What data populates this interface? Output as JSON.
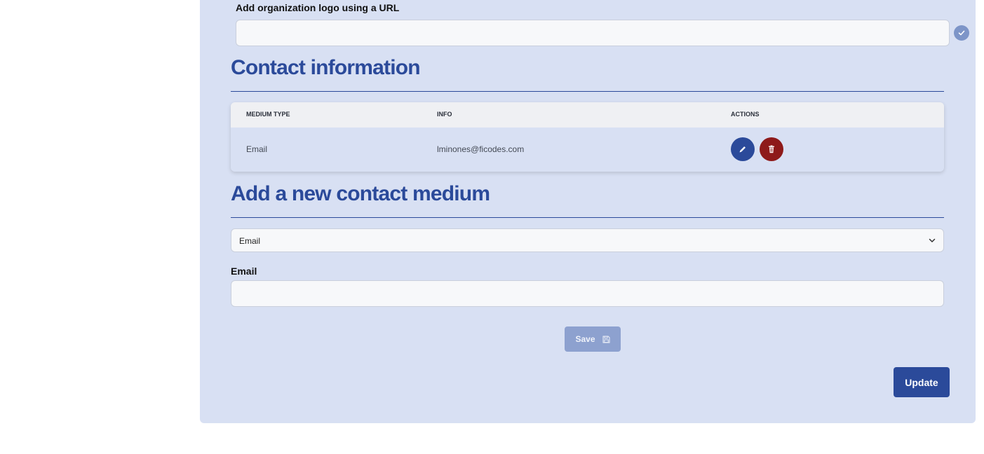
{
  "logo_section": {
    "label": "Add organization logo using a URL",
    "input_value": "",
    "confirm_icon": "check-icon"
  },
  "contact_info": {
    "title": "Contact information",
    "table": {
      "headers": [
        "MEDIUM TYPE",
        "INFO",
        "ACTIONS"
      ],
      "rows": [
        {
          "medium_type": "Email",
          "info": "lminones@ficodes.com",
          "actions": [
            "edit-icon",
            "trash-icon"
          ]
        }
      ]
    }
  },
  "new_contact": {
    "title": "Add a new contact medium",
    "medium_select": {
      "selected": "Email",
      "icon": "chevron-down-icon"
    },
    "email_label": "Email",
    "email_value": "",
    "save_label": "Save",
    "save_icon": "floppy-disk-icon"
  },
  "update_label": "Update",
  "colors": {
    "panel_bg": "#d8e0f3",
    "accent": "#2b4a9a",
    "danger": "#8e1a1a",
    "disabled_button": "#8da1cf"
  }
}
